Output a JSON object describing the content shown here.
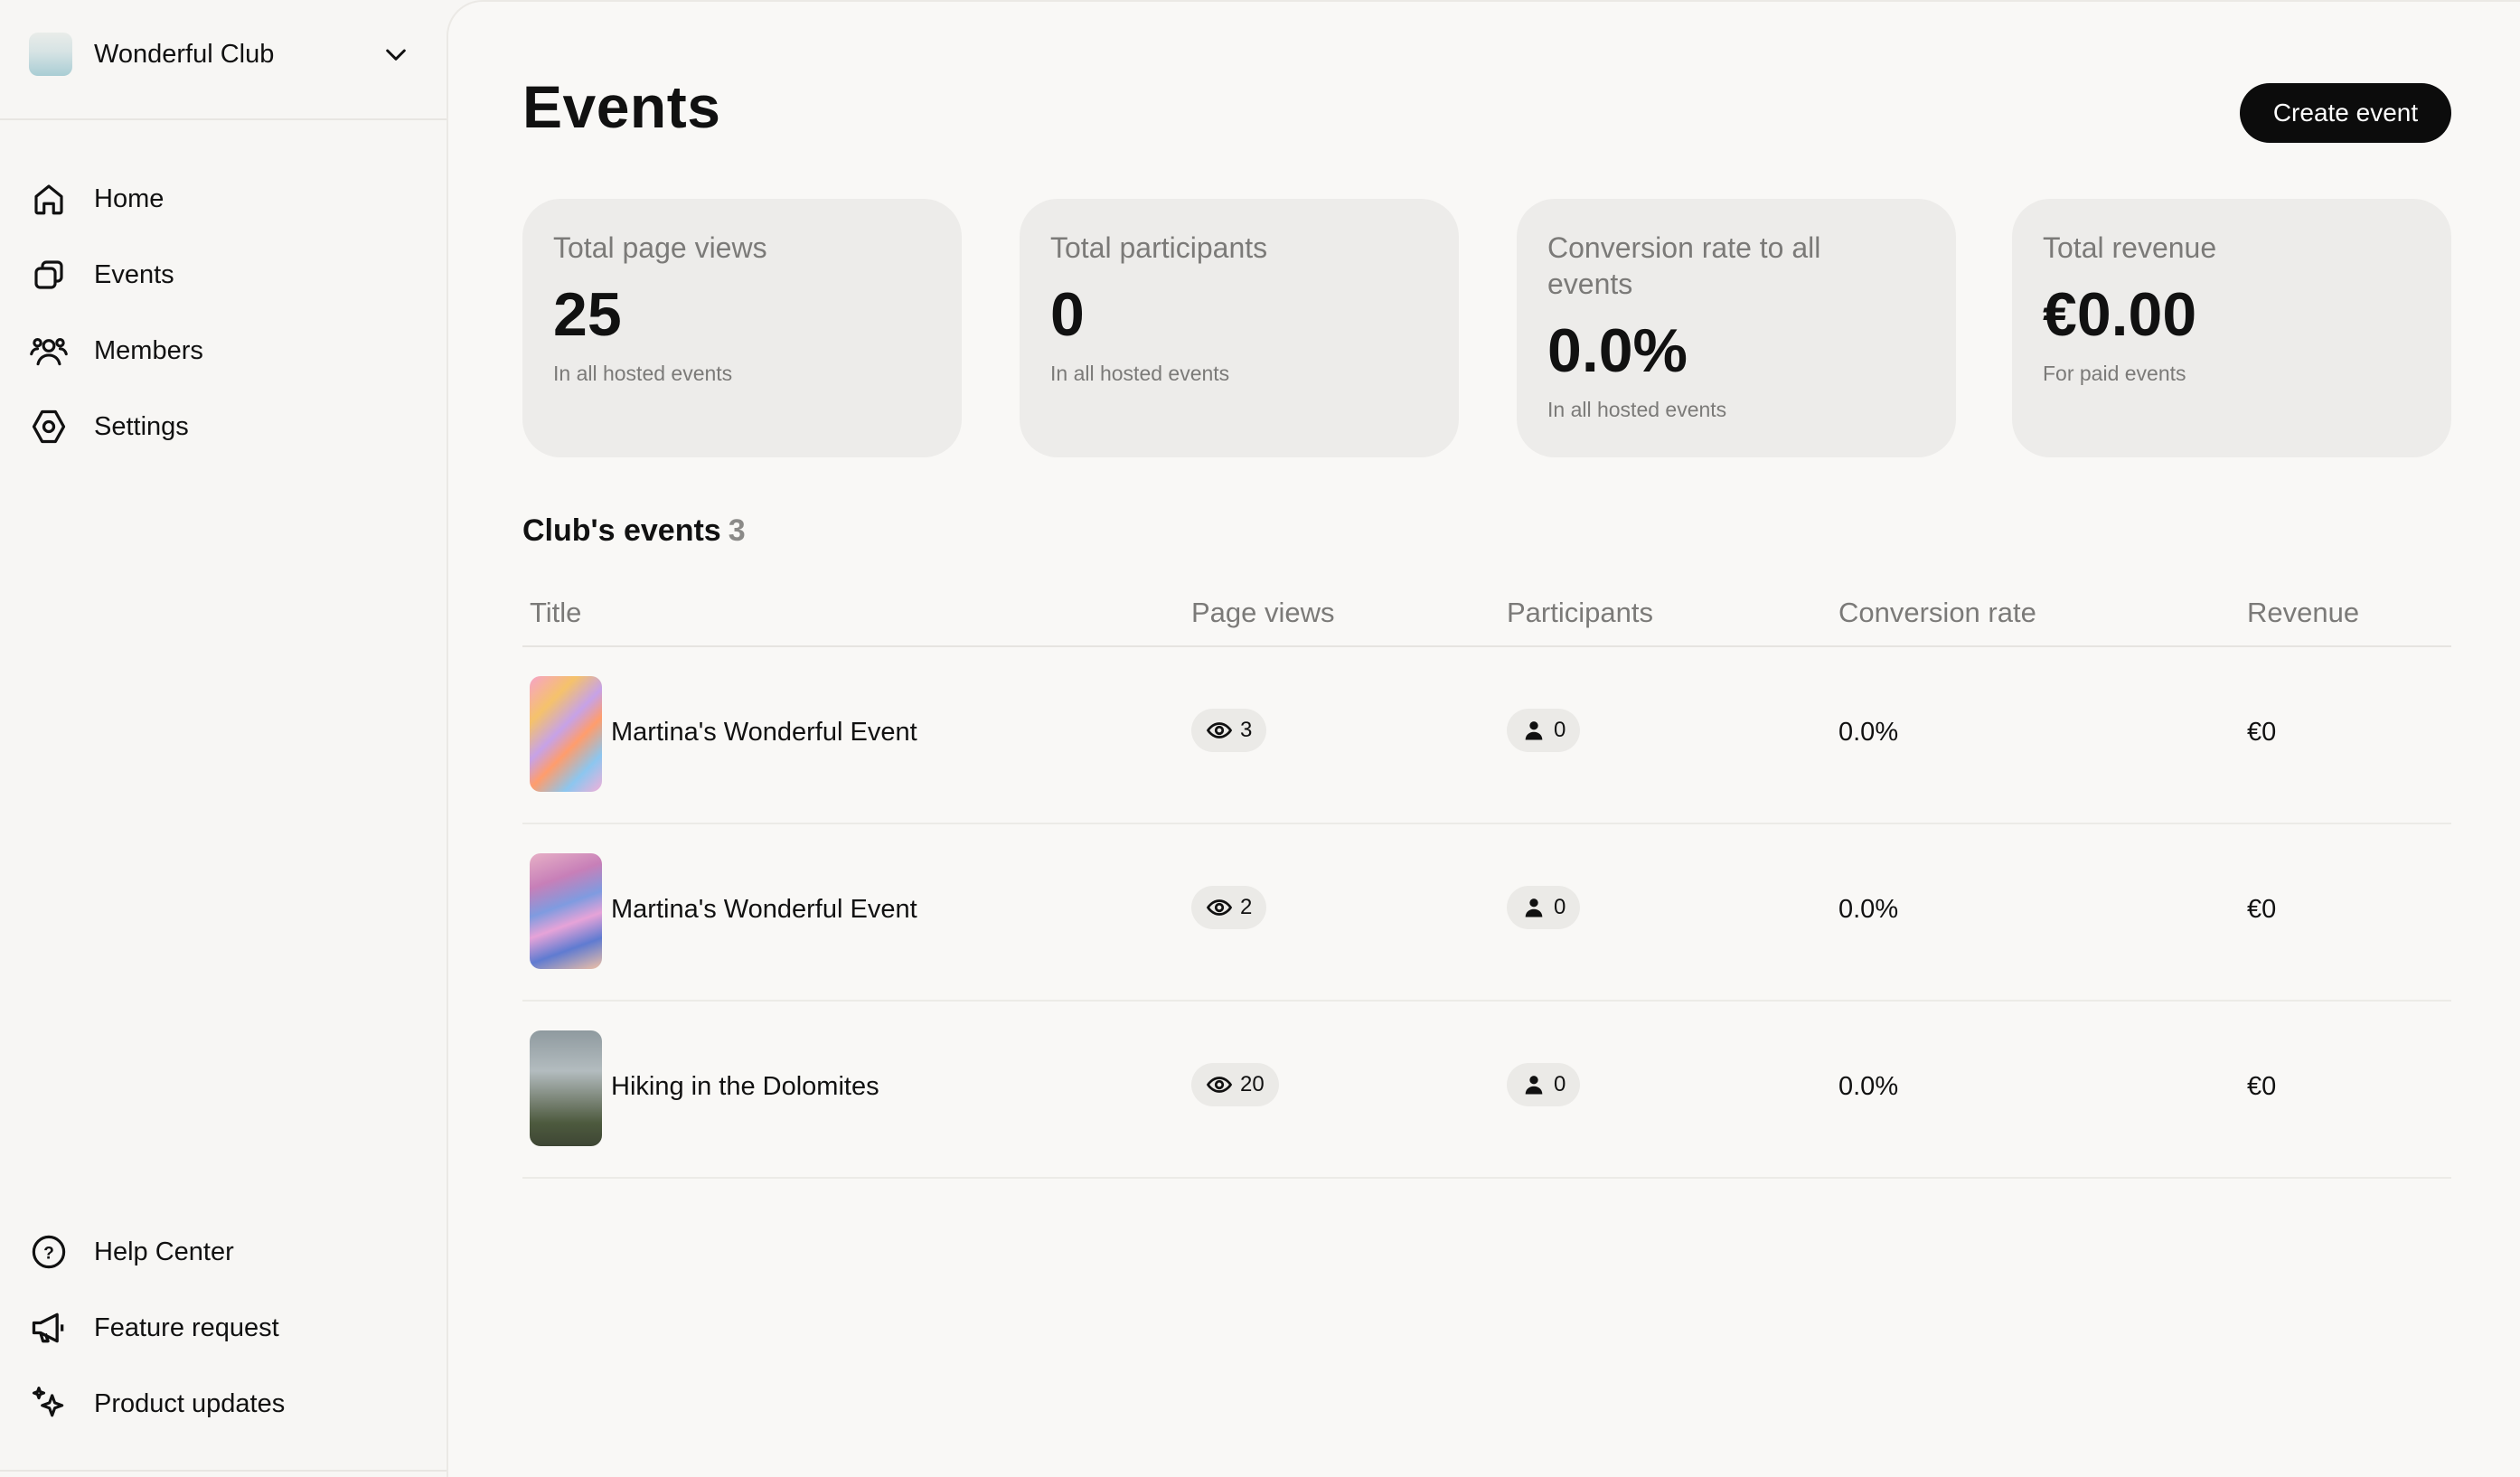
{
  "club": {
    "name": "Wonderful Club"
  },
  "nav": {
    "items": [
      {
        "label": "Home",
        "icon": "home-icon"
      },
      {
        "label": "Events",
        "icon": "events-icon"
      },
      {
        "label": "Members",
        "icon": "members-icon"
      },
      {
        "label": "Settings",
        "icon": "settings-icon"
      }
    ],
    "bottom_items": [
      {
        "label": "Help Center",
        "icon": "help-icon"
      },
      {
        "label": "Feature request",
        "icon": "megaphone-icon"
      },
      {
        "label": "Product updates",
        "icon": "sparkle-icon"
      }
    ]
  },
  "page": {
    "title": "Events",
    "create_button": "Create event"
  },
  "stats": [
    {
      "label": "Total page views",
      "value": "25",
      "sub": "In all hosted events"
    },
    {
      "label": "Total participants",
      "value": "0",
      "sub": "In all hosted events"
    },
    {
      "label": "Conversion rate to all events",
      "value": "0.0%",
      "sub": "In all hosted events"
    },
    {
      "label": "Total revenue",
      "value": "€0.00",
      "sub": "For paid events"
    }
  ],
  "events_section": {
    "title": "Club's events",
    "count": "3"
  },
  "table": {
    "headers": [
      "Title",
      "Page views",
      "Participants",
      "Conversion rate",
      "Revenue"
    ],
    "rows": [
      {
        "title": "Martina's Wonderful Event",
        "views": "3",
        "participants": "0",
        "conversion": "0.0%",
        "revenue": "€0"
      },
      {
        "title": "Martina's Wonderful Event",
        "views": "2",
        "participants": "0",
        "conversion": "0.0%",
        "revenue": "€0"
      },
      {
        "title": "Hiking in the Dolomites",
        "views": "20",
        "participants": "0",
        "conversion": "0.0%",
        "revenue": "€0"
      }
    ]
  },
  "colors": {
    "background": "#f7f6f4",
    "card": "#edecea",
    "primary_button": "#0c0c0c",
    "muted_text": "#7b7a78"
  }
}
